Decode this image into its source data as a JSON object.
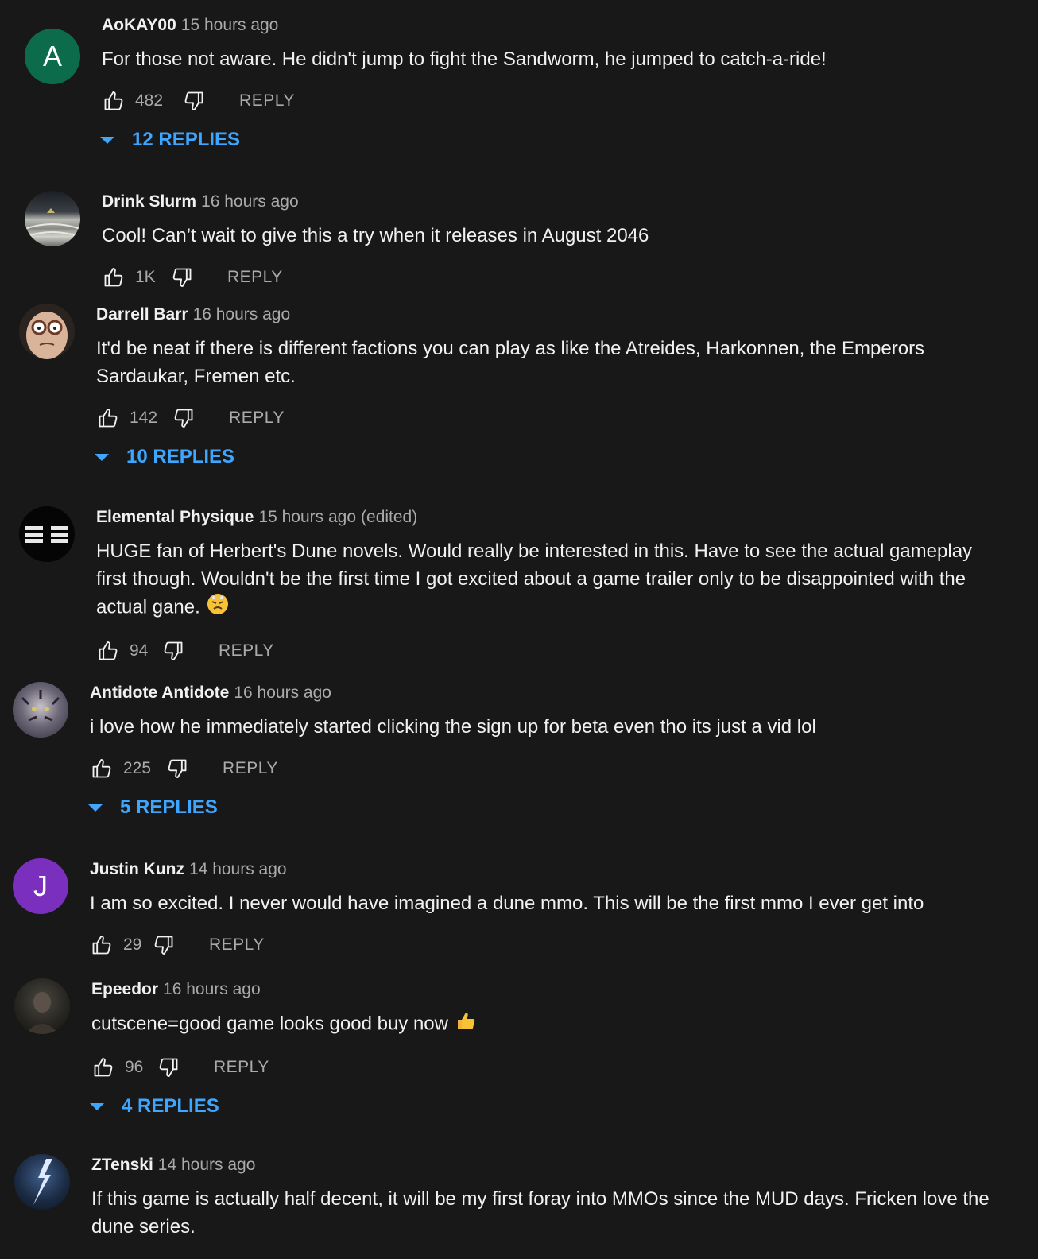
{
  "labels": {
    "reply": "REPLY"
  },
  "colors": {
    "background": "#181818",
    "link": "#3ea6ff",
    "muted": "#aaaaaa",
    "text": "#f1f1f1"
  },
  "comments": [
    {
      "author": "AoKAY00",
      "time": "15 hours ago",
      "text": "For those not aware. He didn't jump to fight the Sandworm, he jumped to catch-a-ride!",
      "likes": "482",
      "replies": "12 REPLIES",
      "avatar": {
        "type": "letter",
        "letter": "A",
        "color": "#0b6b4b"
      }
    },
    {
      "author": "Drink Slurm",
      "time": "16 hours ago",
      "text": "Cool! Can’t wait to give this a try when it releases in August 2046",
      "likes": "1K",
      "avatar": {
        "type": "image",
        "desc": "sand-dunes"
      }
    },
    {
      "author": "Darrell Barr",
      "time": "16 hours ago",
      "text": "It'd be neat if there is different factions you can play as like the Atreides, Harkonnen, the Emperors Sardaukar, Fremen etc.",
      "likes": "142",
      "replies": "10 REPLIES",
      "avatar": {
        "type": "image",
        "desc": "cartoon-face-glasses"
      }
    },
    {
      "author": "Elemental Physique",
      "time": "15 hours ago",
      "edited": "(edited)",
      "text": "HUGE fan of Herbert's Dune novels. Would really be interested in this. Have to see the actual gameplay first though. Wouldn't be the first time I got excited about a game trailer only to be disappointed with the actual gane.",
      "emoji": "frustrated-face-emoji",
      "likes": "94",
      "avatar": {
        "type": "image",
        "desc": "stripe-logo"
      }
    },
    {
      "author": "Antidote Antidote",
      "time": "16 hours ago",
      "text": "i love how he immediately started clicking the sign up for beta even tho its just a vid lol",
      "likes": "225",
      "replies": "5 REPLIES",
      "avatar": {
        "type": "image",
        "desc": "tiger"
      }
    },
    {
      "author": "Justin Kunz",
      "time": "14 hours ago",
      "text": "I am so excited. I never would have imagined a dune mmo. This will be the first mmo I ever get into",
      "likes": "29",
      "avatar": {
        "type": "letter",
        "letter": "J",
        "color": "#7b2fbf"
      }
    },
    {
      "author": "Epeedor",
      "time": "16 hours ago",
      "text": "cutscene=good game looks good buy now",
      "emoji": "thumbs-up-emoji",
      "likes": "96",
      "replies": "4 REPLIES",
      "avatar": {
        "type": "image",
        "desc": "dark-portrait"
      }
    },
    {
      "author": "ZTenski",
      "time": "14 hours ago",
      "text": "If this game is actually half decent, it will be my first foray into MMOs since the MUD days. Fricken love the dune series.",
      "avatar": {
        "type": "image",
        "desc": "lightning-storm"
      }
    }
  ]
}
